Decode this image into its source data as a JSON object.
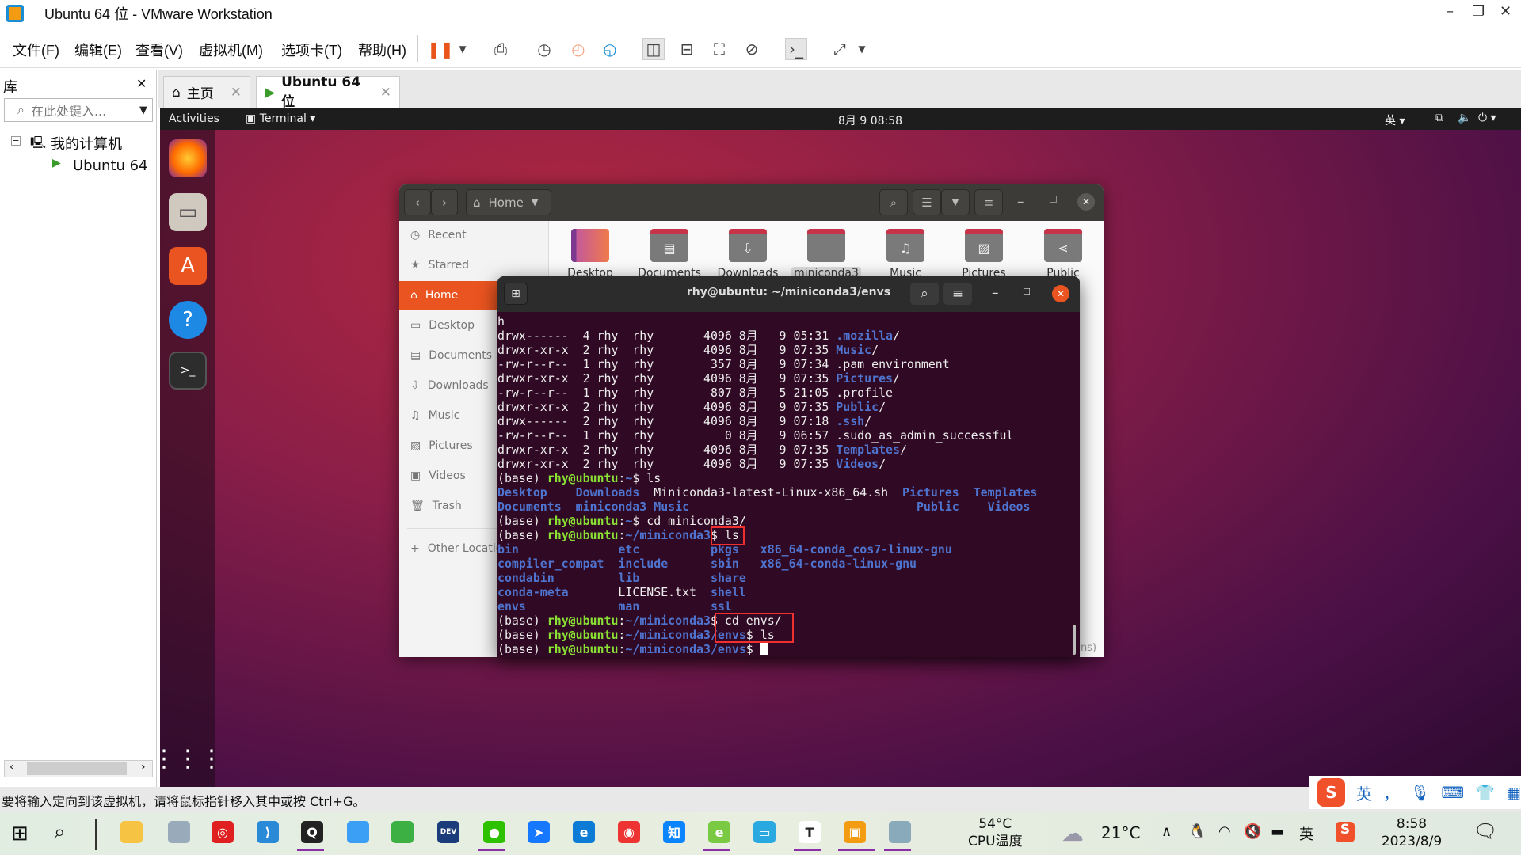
{
  "window": {
    "title": "Ubuntu 64 位 - VMware Workstation",
    "min": "–",
    "max": "❐",
    "close": "✕"
  },
  "menu": [
    "文件(F)",
    "编辑(E)",
    "查看(V)",
    "虚拟机(M)",
    "选项卡(T)",
    "帮助(H)"
  ],
  "library": {
    "title": "库",
    "close": "✕",
    "search_placeholder": "在此处键入...",
    "tree": [
      "我的计算机",
      "Ubuntu 64 位"
    ]
  },
  "tabs": [
    {
      "label": "主页"
    },
    {
      "label": "Ubuntu 64 位"
    }
  ],
  "ubuntu_bar": {
    "activities": "Activities",
    "app": "Terminal",
    "clock": "8月 9 08:58",
    "lang": "英"
  },
  "files": {
    "location": "Home",
    "sidebar": [
      "Recent",
      "Starred",
      "Home",
      "Desktop",
      "Documents",
      "Downloads",
      "Music",
      "Pictures",
      "Videos",
      "Trash",
      "Other Locations"
    ],
    "active": "Home",
    "folders": [
      "Desktop",
      "Documents",
      "Downloads",
      "miniconda3",
      "Music",
      "Pictures",
      "Public"
    ],
    "selected": "miniconda3",
    "hidden_fragment": "ns)",
    "accent": "#e95420"
  },
  "terminal": {
    "title": "rhy@ubuntu: ~/miniconda3/envs",
    "lines": [
      [
        [
          "h",
          "w"
        ]
      ],
      [
        [
          "drwx------  4 rhy  rhy       4096 8月   9 05:31 ",
          "w"
        ],
        [
          ".mozilla",
          "b"
        ],
        [
          "/",
          "w"
        ]
      ],
      [
        [
          "drwxr-xr-x  2 rhy  rhy       4096 8月   9 07:35 ",
          "w"
        ],
        [
          "Music",
          "b"
        ],
        [
          "/",
          "w"
        ]
      ],
      [
        [
          "-rw-r--r--  1 rhy  rhy        357 8月   9 07:34 .pam_environment",
          "w"
        ]
      ],
      [
        [
          "drwxr-xr-x  2 rhy  rhy       4096 8月   9 07:35 ",
          "w"
        ],
        [
          "Pictures",
          "b"
        ],
        [
          "/",
          "w"
        ]
      ],
      [
        [
          "-rw-r--r--  1 rhy  rhy        807 8月   5 21:05 .profile",
          "w"
        ]
      ],
      [
        [
          "drwxr-xr-x  2 rhy  rhy       4096 8月   9 07:35 ",
          "w"
        ],
        [
          "Public",
          "b"
        ],
        [
          "/",
          "w"
        ]
      ],
      [
        [
          "drwx------  2 rhy  rhy       4096 8月   9 07:18 ",
          "w"
        ],
        [
          ".ssh",
          "b"
        ],
        [
          "/",
          "w"
        ]
      ],
      [
        [
          "-rw-r--r--  1 rhy  rhy          0 8月   9 06:57 .sudo_as_admin_successful",
          "w"
        ]
      ],
      [
        [
          "drwxr-xr-x  2 rhy  rhy       4096 8月   9 07:35 ",
          "w"
        ],
        [
          "Templates",
          "b"
        ],
        [
          "/",
          "w"
        ]
      ],
      [
        [
          "drwxr-xr-x  2 rhy  rhy       4096 8月   9 07:35 ",
          "w"
        ],
        [
          "Videos",
          "b"
        ],
        [
          "/",
          "w"
        ]
      ],
      [
        [
          "(base) ",
          "w"
        ],
        [
          "rhy@ubuntu",
          "g"
        ],
        [
          ":",
          "w"
        ],
        [
          "~",
          "b"
        ],
        [
          "$ ls",
          "w"
        ]
      ],
      [
        [
          "Desktop",
          "b"
        ],
        [
          "    ",
          "w"
        ],
        [
          "Downloads",
          "b"
        ],
        [
          "  Miniconda3-latest-Linux-x86_64.sh  ",
          "w"
        ],
        [
          "Pictures",
          "b"
        ],
        [
          "  ",
          "w"
        ],
        [
          "Templates",
          "b"
        ]
      ],
      [
        [
          "Documents",
          "b"
        ],
        [
          "  ",
          "w"
        ],
        [
          "miniconda3",
          "b"
        ],
        [
          " ",
          "w"
        ],
        [
          "Music",
          "b"
        ],
        [
          "                                ",
          "w"
        ],
        [
          "Public",
          "b"
        ],
        [
          "    ",
          "w"
        ],
        [
          "Videos",
          "b"
        ]
      ],
      [
        [
          "(base) ",
          "w"
        ],
        [
          "rhy@ubuntu",
          "g"
        ],
        [
          ":",
          "w"
        ],
        [
          "~",
          "b"
        ],
        [
          "$ cd miniconda3/",
          "w"
        ]
      ],
      [
        [
          "(base) ",
          "w"
        ],
        [
          "rhy@ubuntu",
          "g"
        ],
        [
          ":",
          "w"
        ],
        [
          "~/miniconda3",
          "b"
        ],
        [
          "$ ls",
          "w"
        ]
      ],
      [
        [
          "bin",
          "b"
        ],
        [
          "              ",
          "w"
        ],
        [
          "etc",
          "b"
        ],
        [
          "          ",
          "w"
        ],
        [
          "pkgs",
          "b"
        ],
        [
          "   ",
          "w"
        ],
        [
          "x86_64-conda_cos7-linux-gnu",
          "b"
        ]
      ],
      [
        [
          "compiler_compat",
          "b"
        ],
        [
          "  ",
          "w"
        ],
        [
          "include",
          "b"
        ],
        [
          "      ",
          "w"
        ],
        [
          "sbin",
          "b"
        ],
        [
          "   ",
          "w"
        ],
        [
          "x86_64-conda-linux-gnu",
          "b"
        ]
      ],
      [
        [
          "condabin",
          "b"
        ],
        [
          "         ",
          "w"
        ],
        [
          "lib",
          "b"
        ],
        [
          "          ",
          "w"
        ],
        [
          "share",
          "b"
        ]
      ],
      [
        [
          "conda-meta",
          "b"
        ],
        [
          "       LICENSE.txt  ",
          "w"
        ],
        [
          "shell",
          "b"
        ]
      ],
      [
        [
          "envs",
          "b"
        ],
        [
          "             ",
          "w"
        ],
        [
          "man",
          "b"
        ],
        [
          "          ",
          "w"
        ],
        [
          "ssl",
          "b"
        ]
      ],
      [
        [
          "(base) ",
          "w"
        ],
        [
          "rhy@ubuntu",
          "g"
        ],
        [
          ":",
          "w"
        ],
        [
          "~/miniconda3",
          "b"
        ],
        [
          "$ cd envs/",
          "w"
        ]
      ],
      [
        [
          "(base) ",
          "w"
        ],
        [
          "rhy@ubuntu",
          "g"
        ],
        [
          ":",
          "w"
        ],
        [
          "~/miniconda3/envs",
          "b"
        ],
        [
          "$ ls",
          "w"
        ]
      ],
      [
        [
          "(base) ",
          "w"
        ],
        [
          "rhy@ubuntu",
          "g"
        ],
        [
          ":",
          "w"
        ],
        [
          "~/miniconda3/envs",
          "b"
        ],
        [
          "$ ",
          "w"
        ]
      ]
    ],
    "bg": "#300a24"
  },
  "statusbar": "要将输入定向到该虚拟机，请将鼠标指针移入其中或按 Ctrl+G。",
  "taskbar": {
    "cpu_temp": "54°C",
    "cpu_label": "CPU温度",
    "weather": "21°C",
    "ime": "英",
    "time": "8:58",
    "date": "2023/8/9"
  },
  "ime_bar": {
    "lang": "英",
    "punct": "，"
  }
}
